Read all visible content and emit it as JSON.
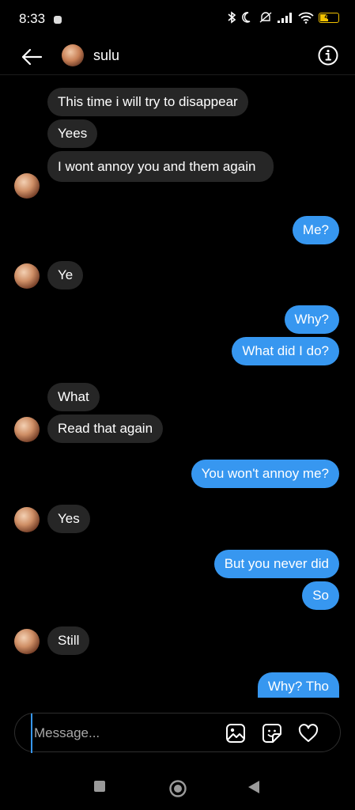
{
  "status": {
    "time": "8:33",
    "battery": "43",
    "battery_level": 0.43
  },
  "header": {
    "contact_name": "sulu",
    "back_icon": "arrow-left-icon",
    "info_icon": "info-icon"
  },
  "messages": [
    {
      "from": "them",
      "text": "This time i will try to disappear"
    },
    {
      "from": "them",
      "text": "Yees"
    },
    {
      "from": "them",
      "text": "I wont annoy you and them again"
    },
    {
      "from": "me",
      "text": "Me?"
    },
    {
      "from": "them",
      "text": "Ye"
    },
    {
      "from": "me",
      "text": "Why?"
    },
    {
      "from": "me",
      "text": "What did I do?"
    },
    {
      "from": "them",
      "text": "What"
    },
    {
      "from": "them",
      "text": "Read that again"
    },
    {
      "from": "me",
      "text": "You won't annoy me?"
    },
    {
      "from": "them",
      "text": "Yes"
    },
    {
      "from": "me",
      "text": "But you never did"
    },
    {
      "from": "me",
      "text": "So"
    },
    {
      "from": "them",
      "text": "Still"
    },
    {
      "from": "me",
      "text": "Why? Tho"
    }
  ],
  "composer": {
    "placeholder": "Message...",
    "icons": [
      "image-icon",
      "sticker-icon",
      "heart-icon"
    ]
  },
  "navbar": {
    "icons": [
      "recents-square-icon",
      "home-circle-icon",
      "back-triangle-icon"
    ]
  },
  "colors": {
    "incoming_bubble": "#262626",
    "outgoing_bubble": "#3797f0",
    "background": "#000000"
  }
}
